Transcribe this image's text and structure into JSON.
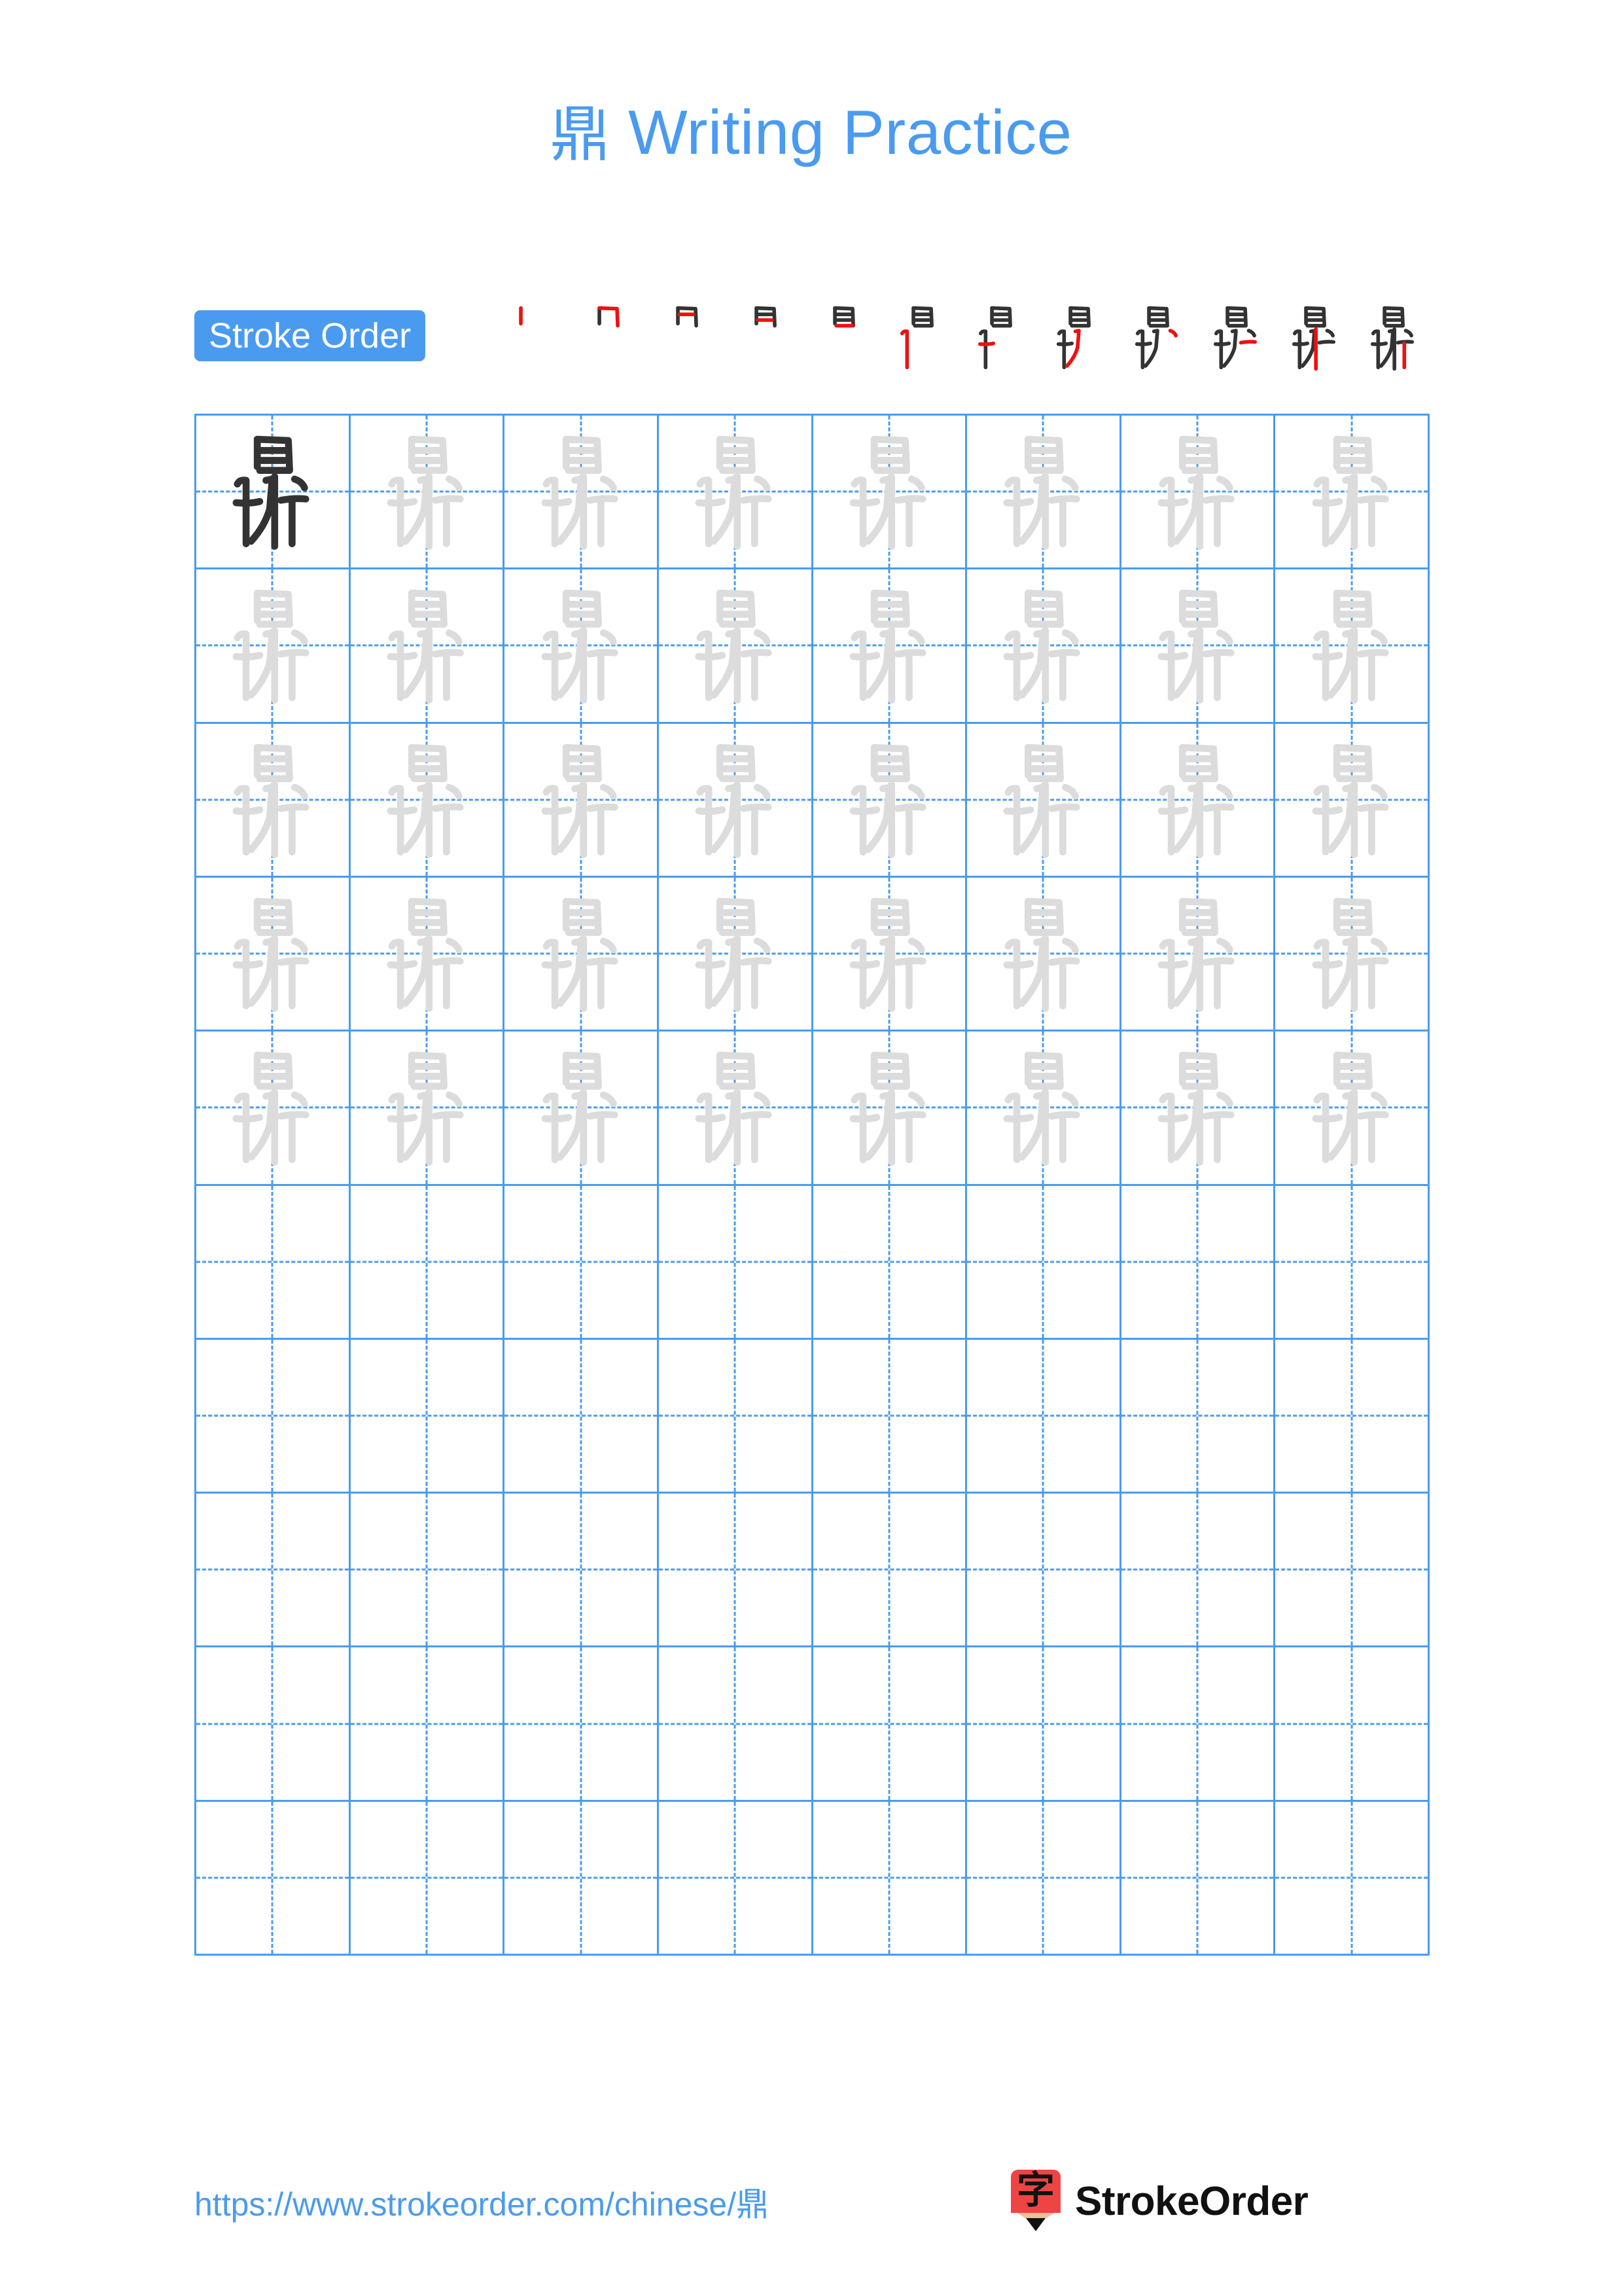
{
  "page": {
    "title_character": "鼎",
    "title_text": "Writing Practice",
    "background_color": "#ffffff",
    "accent_color": "#4a9bef",
    "grid_line_color": "#4a9bef",
    "model_character_color": "#333333",
    "trace_character_color": "#dcdcdc",
    "new_stroke_color": "#ee1111",
    "prior_stroke_color": "#333333"
  },
  "stroke_order": {
    "badge_label": "Stroke Order",
    "character": "鼎",
    "total_strokes": 12,
    "steps": [
      {
        "index": 1,
        "label": "stroke-step-1"
      },
      {
        "index": 2,
        "label": "stroke-step-2"
      },
      {
        "index": 3,
        "label": "stroke-step-3"
      },
      {
        "index": 4,
        "label": "stroke-step-4"
      },
      {
        "index": 5,
        "label": "stroke-step-5"
      },
      {
        "index": 6,
        "label": "stroke-step-6"
      },
      {
        "index": 7,
        "label": "stroke-step-7"
      },
      {
        "index": 8,
        "label": "stroke-step-8"
      },
      {
        "index": 9,
        "label": "stroke-step-9"
      },
      {
        "index": 10,
        "label": "stroke-step-10"
      },
      {
        "index": 11,
        "label": "stroke-step-11"
      },
      {
        "index": 12,
        "label": "stroke-step-12"
      }
    ]
  },
  "practice_grid": {
    "columns": 8,
    "rows": 10,
    "character": "鼎",
    "filled_rows": 5,
    "empty_rows": 5,
    "cells": [
      [
        "model",
        "trace",
        "trace",
        "trace",
        "trace",
        "trace",
        "trace",
        "trace"
      ],
      [
        "trace",
        "trace",
        "trace",
        "trace",
        "trace",
        "trace",
        "trace",
        "trace"
      ],
      [
        "trace",
        "trace",
        "trace",
        "trace",
        "trace",
        "trace",
        "trace",
        "trace"
      ],
      [
        "trace",
        "trace",
        "trace",
        "trace",
        "trace",
        "trace",
        "trace",
        "trace"
      ],
      [
        "trace",
        "trace",
        "trace",
        "trace",
        "trace",
        "trace",
        "trace",
        "trace"
      ],
      [
        "empty",
        "empty",
        "empty",
        "empty",
        "empty",
        "empty",
        "empty",
        "empty"
      ],
      [
        "empty",
        "empty",
        "empty",
        "empty",
        "empty",
        "empty",
        "empty",
        "empty"
      ],
      [
        "empty",
        "empty",
        "empty",
        "empty",
        "empty",
        "empty",
        "empty",
        "empty"
      ],
      [
        "empty",
        "empty",
        "empty",
        "empty",
        "empty",
        "empty",
        "empty",
        "empty"
      ],
      [
        "empty",
        "empty",
        "empty",
        "empty",
        "empty",
        "empty",
        "empty",
        "empty"
      ]
    ]
  },
  "footer": {
    "url": "https://www.strokeorder.com/chinese/鼎",
    "brand_name": "StrokeOrder",
    "logo_character": "字"
  }
}
